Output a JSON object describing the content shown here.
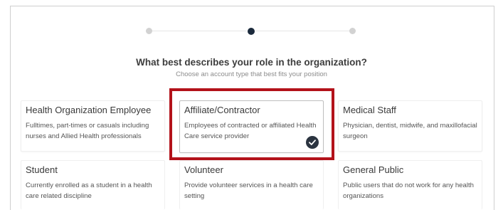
{
  "stepper": {
    "steps": [
      {
        "state": "complete"
      },
      {
        "state": "current"
      },
      {
        "state": "upcoming"
      }
    ]
  },
  "heading": "What best describes your role in the organization?",
  "subheading": "Choose an account type that best fits your position",
  "roles": [
    {
      "title": "Health Organization Employee",
      "description": "Fulltimes, part-times or casuals including nurses and Allied Health professionals",
      "selected": false
    },
    {
      "title": "Affiliate/Contractor",
      "description": "Employees of contracted or affiliated Health Care service provider",
      "selected": true
    },
    {
      "title": "Medical Staff",
      "description": "Physician, dentist, midwife, and maxillofacial surgeon",
      "selected": false
    },
    {
      "title": "Student",
      "description": "Currently enrolled as a student in a health care related discipline",
      "selected": false
    },
    {
      "title": "Volunteer",
      "description": "Provide volunteer services in a health care setting",
      "selected": false
    },
    {
      "title": "General Public",
      "description": "Public users that do not work for any health organizations",
      "selected": false
    }
  ],
  "colors": {
    "highlight": "#b3121a",
    "active_dot": "#1b2a3c",
    "check_badge": "#2b3440"
  },
  "icons": {
    "selected_badge": "check-circle-icon"
  }
}
